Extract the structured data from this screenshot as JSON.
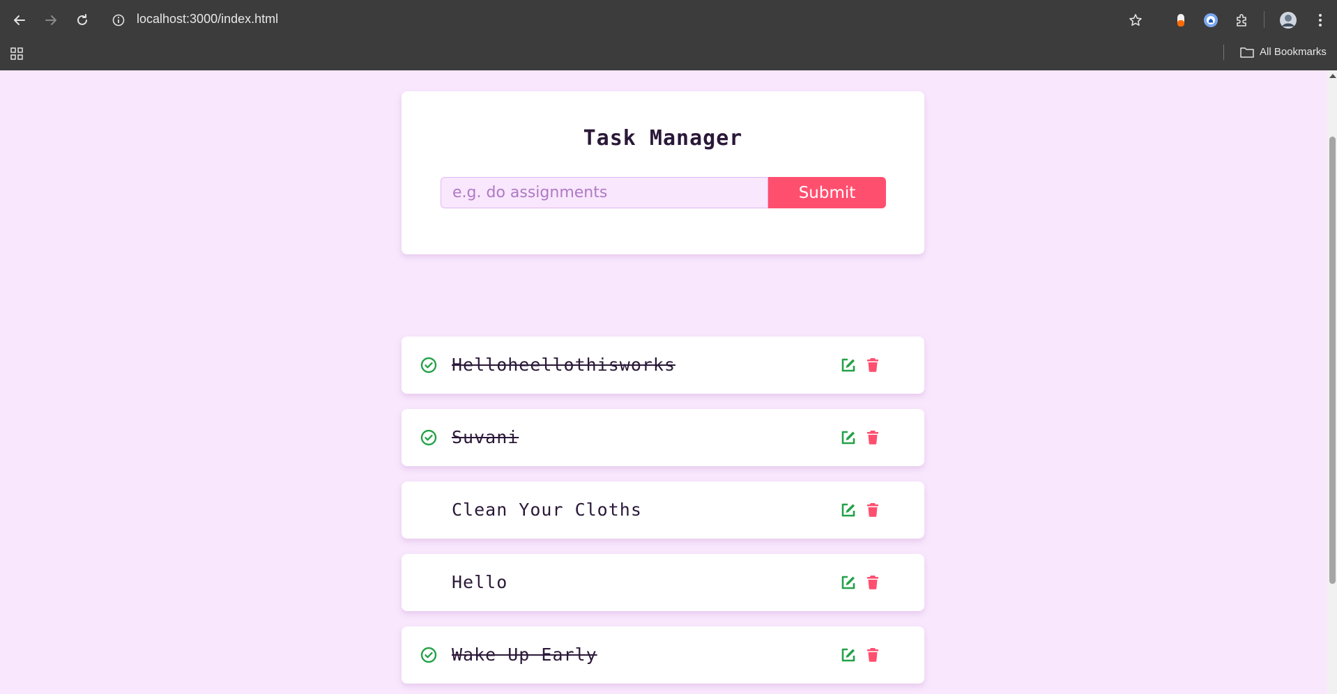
{
  "browser": {
    "url": "localhost:3000/index.html",
    "bookmarks_label": "All Bookmarks"
  },
  "app": {
    "title": "Task Manager",
    "input_placeholder": "e.g. do assignments",
    "input_value": "",
    "submit_label": "Submit"
  },
  "tasks": [
    {
      "text": "Helloheellothisworks",
      "completed": true
    },
    {
      "text": "Suvani",
      "completed": true
    },
    {
      "text": "Clean Your Cloths",
      "completed": false
    },
    {
      "text": "Hello",
      "completed": false
    },
    {
      "text": "Wake Up Early",
      "completed": true
    }
  ],
  "colors": {
    "background": "#f8e7fd",
    "accent": "#ff4f6f",
    "check": "#24a148",
    "edit": "#24a148",
    "delete": "#ff4f6f"
  }
}
